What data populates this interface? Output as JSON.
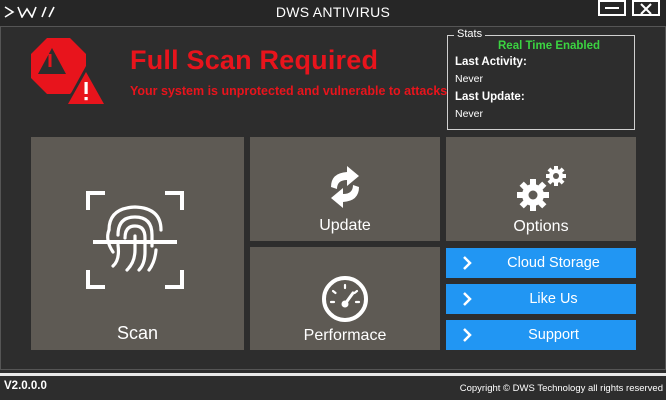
{
  "window": {
    "title": "DWS ANTIVIRUS",
    "logo_text": "DWS"
  },
  "alert": {
    "title": "Full Scan Required",
    "subtitle": "Your system is unprotected and vulnerable to attacks",
    "color": "#e8141c"
  },
  "stats": {
    "legend": "Stats",
    "realtime_status": "Real Time Enabled",
    "last_activity_label": "Last Activity:",
    "last_activity_value": "Never",
    "last_update_label": "Last Update:",
    "last_update_value": "Never"
  },
  "tiles": {
    "scan": "Scan",
    "update": "Update",
    "options": "Options",
    "performance": "Performace"
  },
  "buttons": {
    "cloud_storage": "Cloud Storage",
    "like_us": "Like Us",
    "support": "Support"
  },
  "footer": {
    "version": "V2.0.0.0",
    "copyright": "Copyright © DWS Technology all rights reserved"
  },
  "colors": {
    "accent_blue": "#2196f3",
    "tile": "#5e5a54",
    "status_green": "#3bd441"
  }
}
